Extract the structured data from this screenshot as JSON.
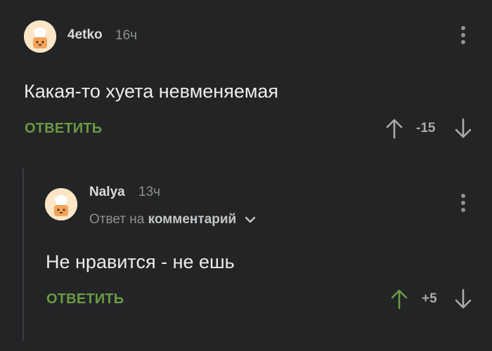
{
  "comments": [
    {
      "username": "4etko",
      "time": "16ч",
      "text": "Какая-то хуета невменяемая",
      "reply_label": "ОТВЕТИТЬ",
      "score": "-15"
    },
    {
      "username": "Nalya",
      "time": "13ч",
      "reply_to_prefix": "Ответ на",
      "reply_to_target": "комментарий",
      "text": "Не нравится - не ешь",
      "reply_label": "ОТВЕТИТЬ",
      "score": "+5",
      "upvoted": true
    }
  ],
  "icons": {
    "avatar": "chef-cat-avatar-icon",
    "more": "more-vertical-icon",
    "upvote": "arrow-up-icon",
    "downvote": "arrow-down-icon",
    "expand": "chevron-down-icon"
  },
  "colors": {
    "background": "#222426",
    "accent": "#6a9a44",
    "muted": "#8e9091",
    "vote_neutral": "#a9abad",
    "upvote_active": "#6a9a44"
  }
}
